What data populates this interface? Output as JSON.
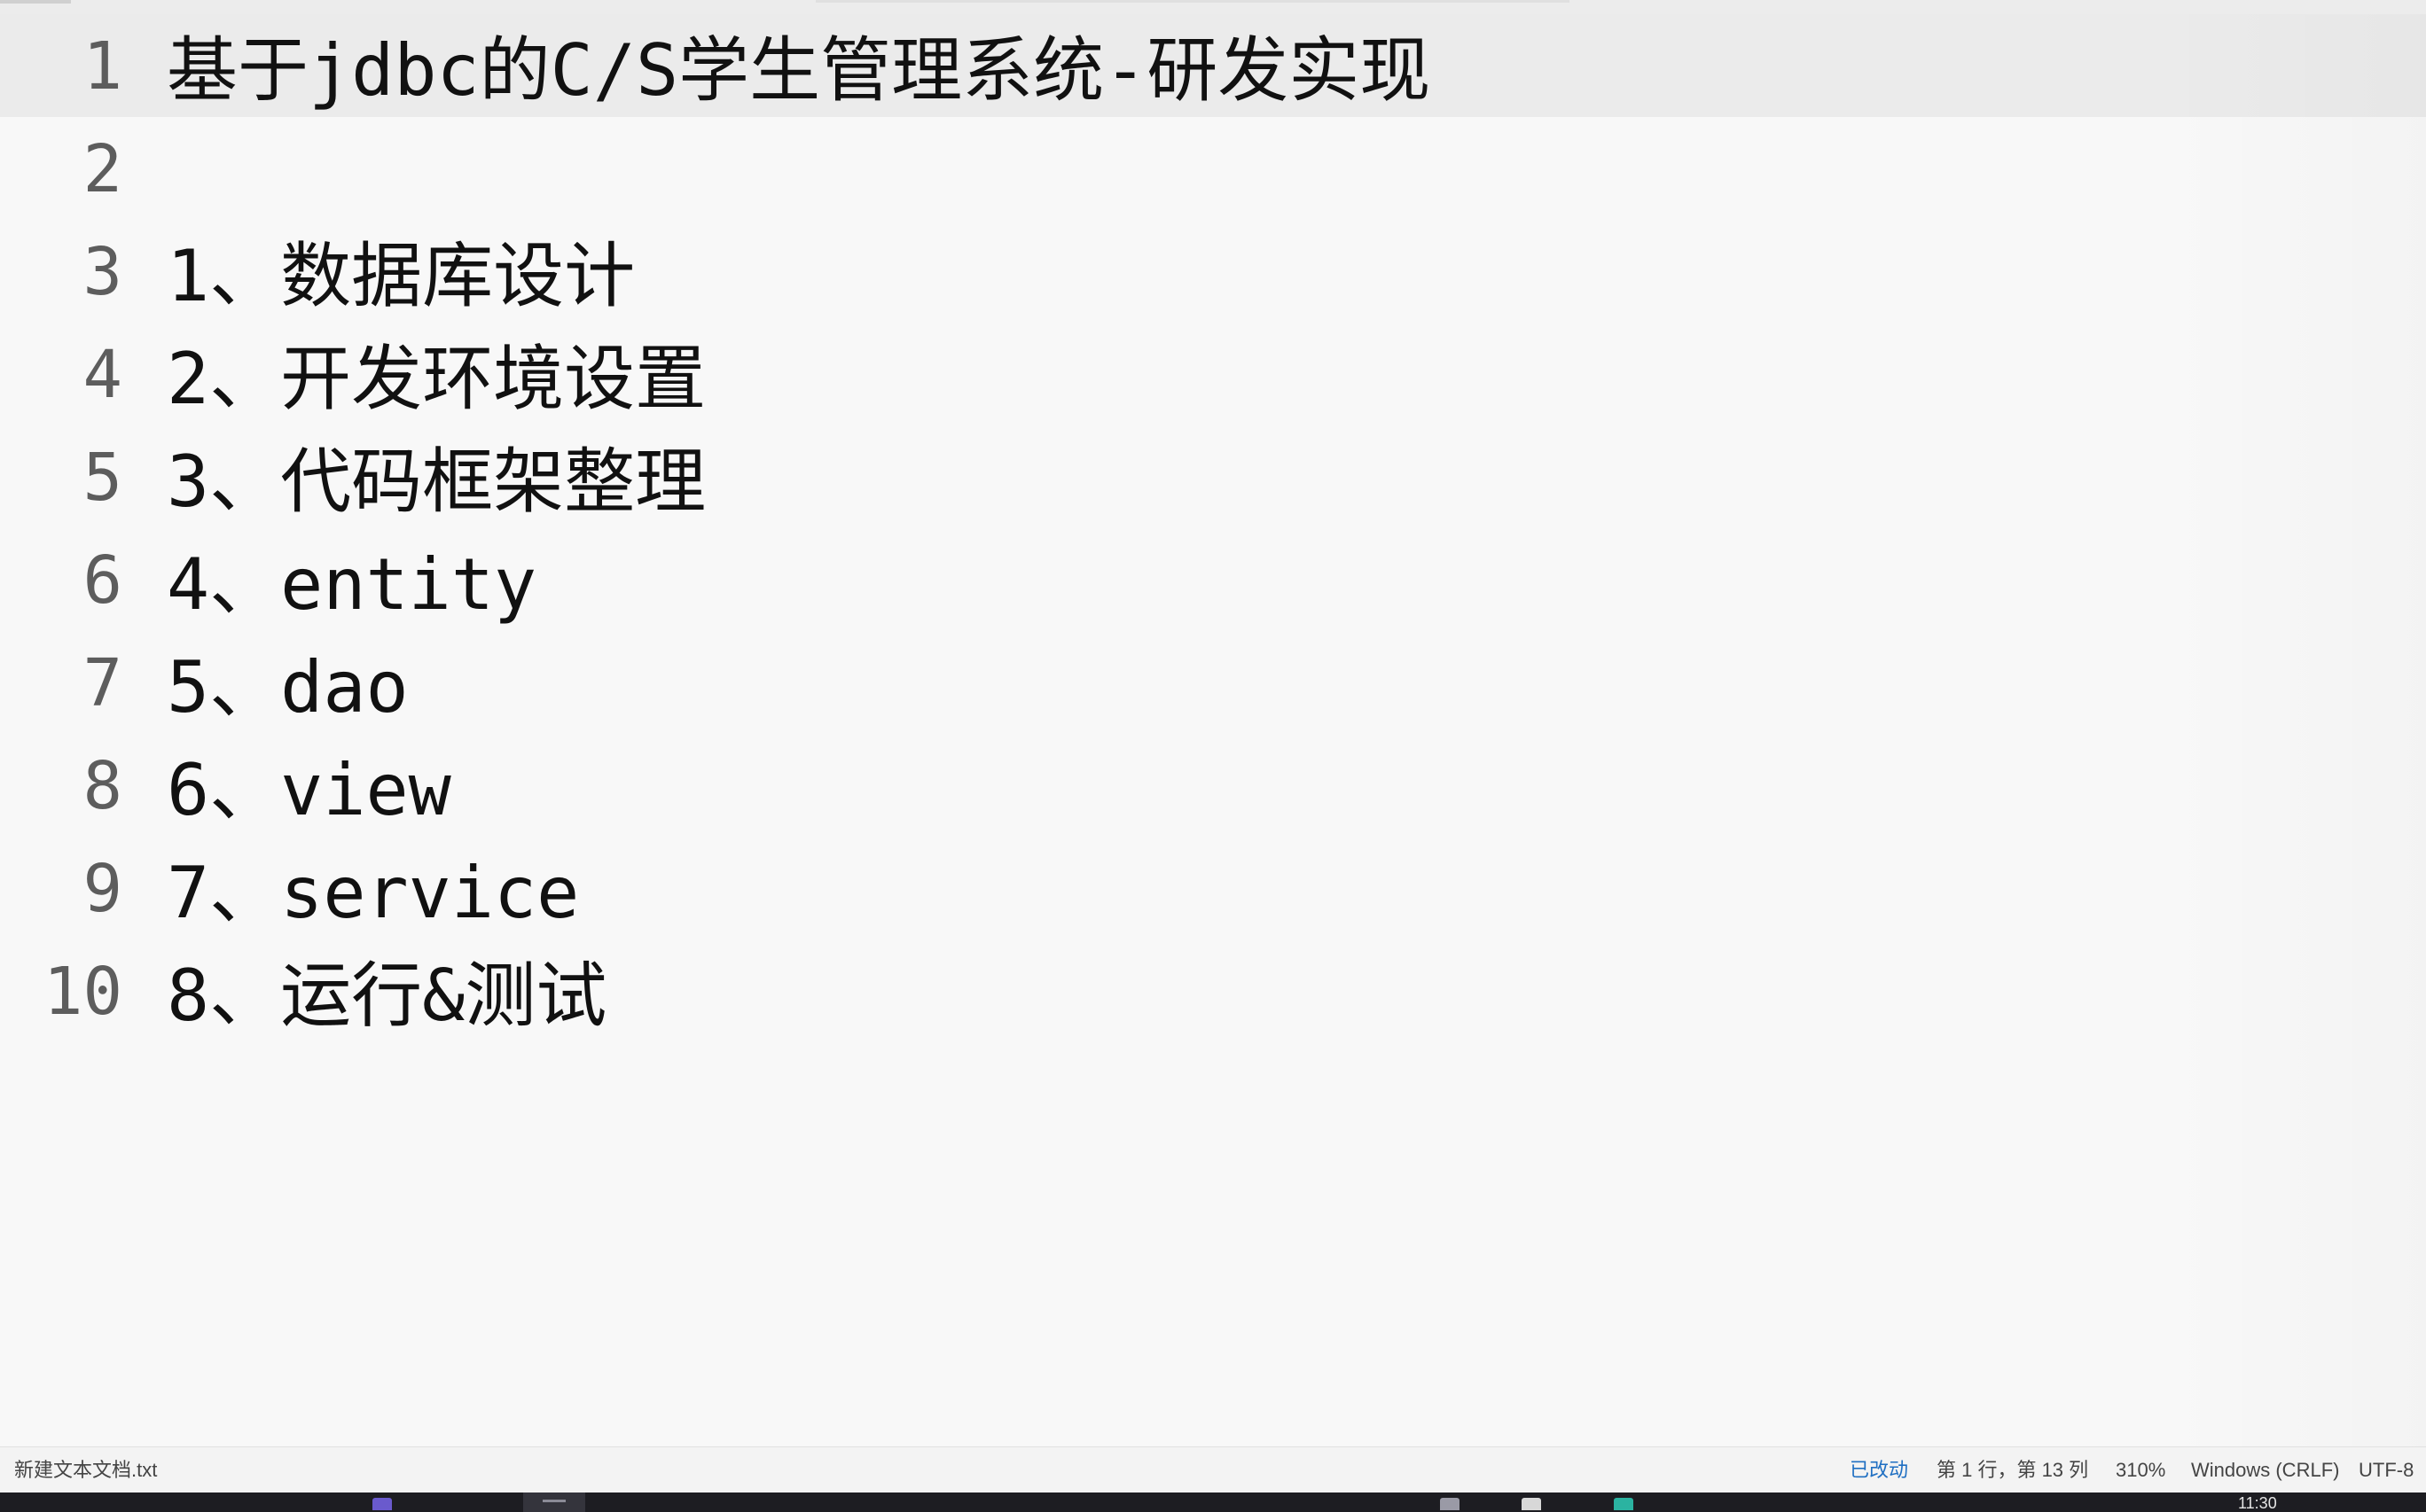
{
  "editor": {
    "lines": [
      {
        "number": "1",
        "text": "基于jdbc的C/S学生管理系统-研发实现"
      },
      {
        "number": "2",
        "text": ""
      },
      {
        "number": "3",
        "text": "1、数据库设计"
      },
      {
        "number": "4",
        "text": "2、开发环境设置"
      },
      {
        "number": "5",
        "text": "3、代码框架整理"
      },
      {
        "number": "6",
        "text": "4、entity"
      },
      {
        "number": "7",
        "text": "5、dao"
      },
      {
        "number": "8",
        "text": "6、view"
      },
      {
        "number": "9",
        "text": "7、service"
      },
      {
        "number": "10",
        "text": "8、运行&测试"
      }
    ],
    "current_line": 1
  },
  "statusbar": {
    "filename": "新建文本文档.txt",
    "modified": "已改动",
    "position": "第 1 行，第 13 列",
    "zoom": "310%",
    "line_ending": "Windows (CRLF)",
    "encoding": "UTF-8"
  },
  "taskbar": {
    "clock": "11:30"
  },
  "colors": {
    "background": "#f8f8f8",
    "current_line_highlight": "#ebebeb",
    "modified_indicator": "#1f6fc2",
    "text": "#111111",
    "gutter_text": "#5d5d5d"
  }
}
